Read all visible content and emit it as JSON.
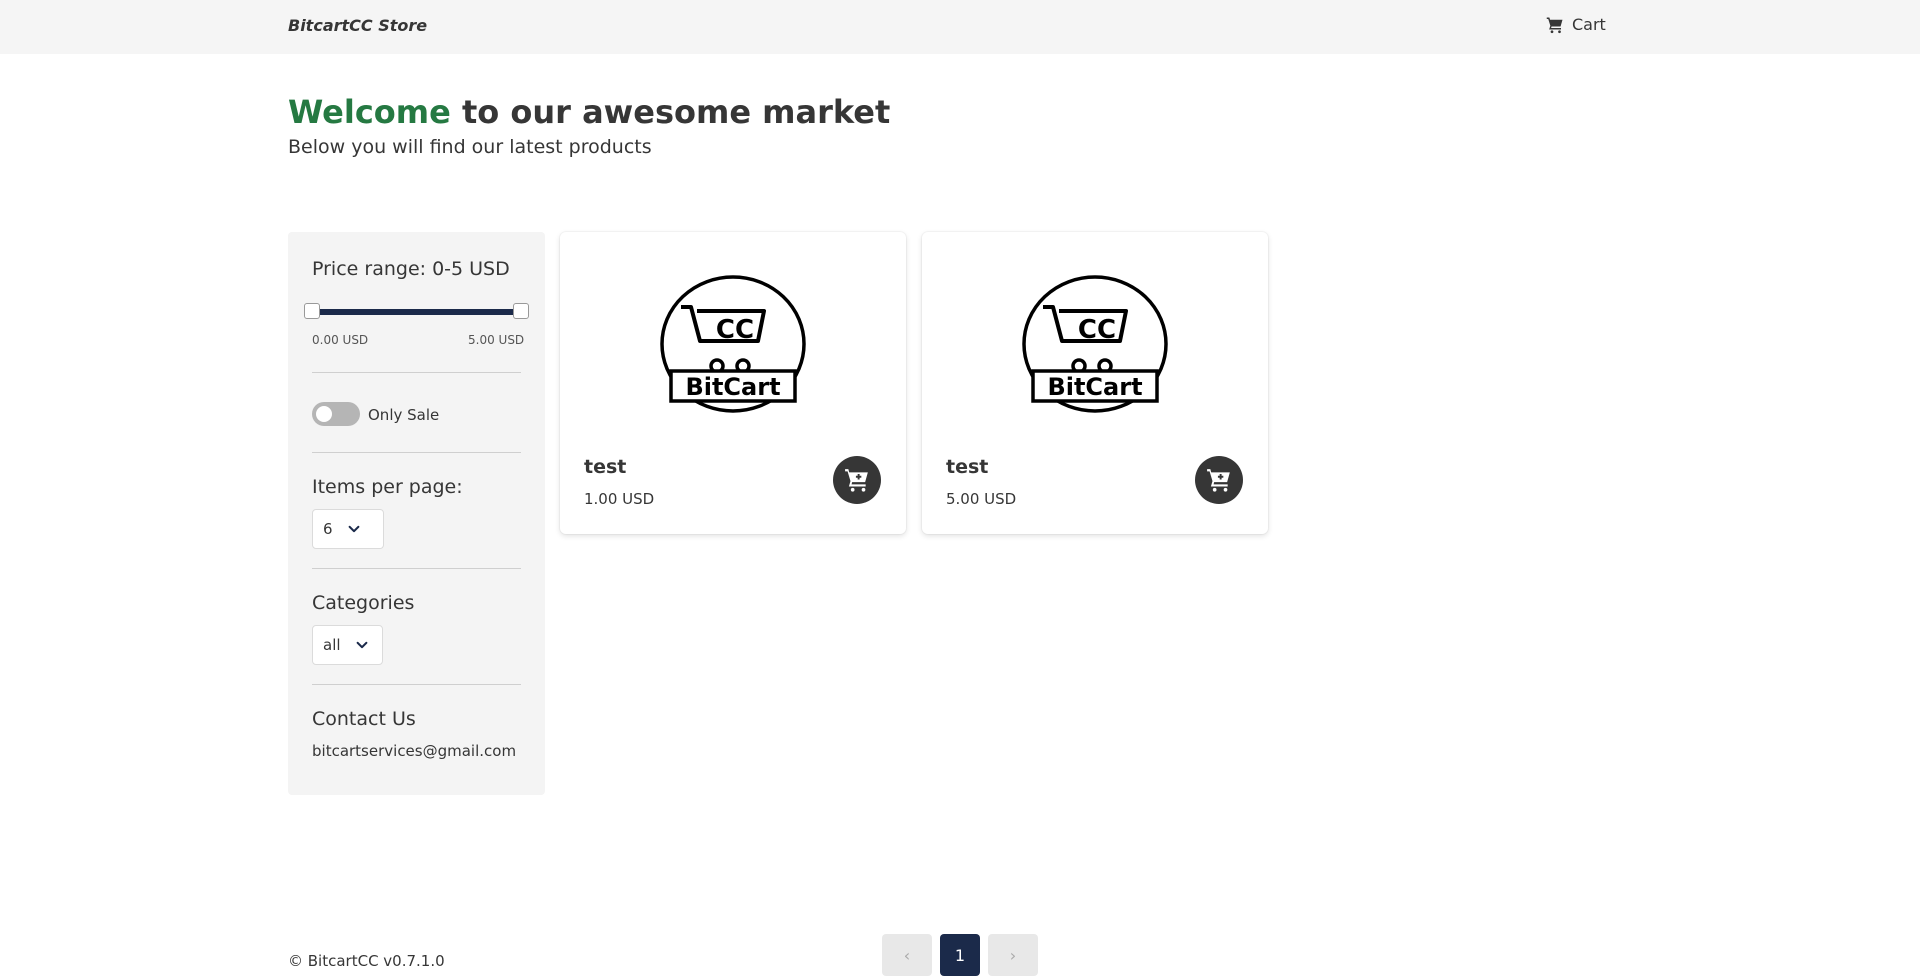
{
  "navbar": {
    "brand": "BitcartCC Store",
    "cart_label": "Cart"
  },
  "hero": {
    "title_accent": "Welcome",
    "title_rest": " to our awesome market",
    "subtitle": "Below you will find our latest products"
  },
  "filters": {
    "price_title": "Price range: 0-5 USD",
    "price_min": "0.00 USD",
    "price_max": "5.00 USD",
    "price_range_values": [
      0,
      5
    ],
    "only_sale_label": "Only Sale",
    "only_sale_on": false,
    "items_per_page_title": "Items per page:",
    "items_per_page_value": "6",
    "categories_title": "Categories",
    "categories_value": "all",
    "contact_title": "Contact Us",
    "contact_email": "bitcartservices@gmail.com"
  },
  "products": [
    {
      "name": "test",
      "price": "1.00 USD",
      "logo_top": "CC",
      "logo_bottom": "BitCart"
    },
    {
      "name": "test",
      "price": "5.00 USD",
      "logo_top": "CC",
      "logo_bottom": "BitCart"
    }
  ],
  "pagination": {
    "prev": "‹",
    "current": "1",
    "next": "›"
  },
  "footer": {
    "text": "© BitcartCC v0.7.1.0"
  },
  "colors": {
    "accent_green": "#257942",
    "navy": "#1b2a4a",
    "dark": "#363636"
  }
}
